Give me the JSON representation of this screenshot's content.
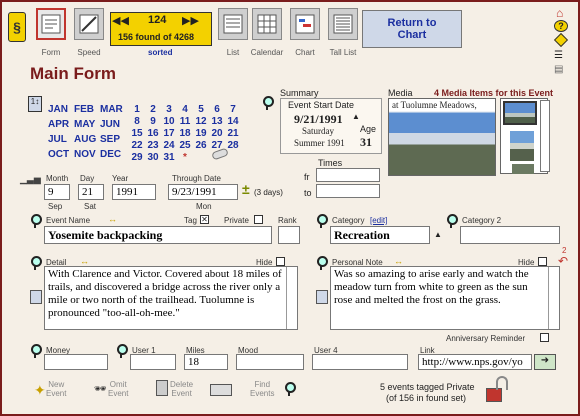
{
  "toolbar": {
    "form_label": "Form",
    "speed_label": "Speed",
    "record_number": "124",
    "found_text": "156 found of 4268",
    "sorted_label": "sorted",
    "list_label": "List",
    "calendar_label": "Calendar",
    "chart_label": "Chart",
    "tall_list_label": "Tall List",
    "return_button": "Return to\nChart"
  },
  "page_title": "Main Form",
  "calendar": {
    "months": [
      "JAN",
      "FEB",
      "MAR",
      "APR",
      "MAY",
      "JUN",
      "JUL",
      "AUG",
      "SEP",
      "OCT",
      "NOV",
      "DEC"
    ],
    "days_rows": [
      [
        "1",
        "2",
        "3",
        "4",
        "5",
        "6",
        "7"
      ],
      [
        "8",
        "9",
        "10",
        "11",
        "12",
        "13",
        "14"
      ],
      [
        "15",
        "16",
        "17",
        "18",
        "19",
        "20",
        "21"
      ],
      [
        "22",
        "23",
        "24",
        "25",
        "26",
        "27",
        "28"
      ],
      [
        "29",
        "30",
        "31",
        "*"
      ]
    ]
  },
  "summary": {
    "heading": "Summary",
    "start_label": "Event Start Date",
    "start_date": "9/21/1991",
    "weekday": "Saturday",
    "season": "Summer 1991",
    "age_label": "Age",
    "age": "31"
  },
  "media": {
    "heading": "Media",
    "count_text": "4 Media Items for this Event",
    "caption": "at Tuolumne Meadows,"
  },
  "times": {
    "heading": "Times",
    "fr_label": "fr",
    "to_label": "to"
  },
  "date": {
    "month_label": "Month",
    "day_label": "Day",
    "year_label": "Year",
    "through_label": "Through Date",
    "month": "9",
    "day": "21",
    "year": "1991",
    "through": "9/23/1991",
    "month_sub": "Sep",
    "day_sub": "Sat",
    "through_sub": "Mon",
    "duration": "(3 days)"
  },
  "event": {
    "name_label": "Event Name",
    "name": "Yosemite backpacking",
    "tag_label": "Tag",
    "private_label": "Private",
    "rank_label": "Rank",
    "category_label": "Category",
    "category_edit": "[edit]",
    "category": "Recreation",
    "category2_label": "Category 2"
  },
  "detail": {
    "label": "Detail",
    "hide_label": "Hide",
    "text": "With Clarence and Victor. Covered about 18 miles of trails, and discovered a bridge across the river only a mile or two north of the trailhead. Tuolumne is pronounced \"too-all-oh-mee.\""
  },
  "personal": {
    "label": "Personal Note",
    "hide_label": "Hide",
    "count": "2",
    "text": "Was so amazing to arise early and watch the meadow turn from white to green as the sun rose and melted the frost on the grass.",
    "anniversary_label": "Anniversary Reminder"
  },
  "bottom_fields": {
    "money_label": "Money",
    "user1_label": "User 1",
    "miles_label": "Miles",
    "miles": "18",
    "mood_label": "Mood",
    "user4_label": "User 4",
    "link_label": "Link",
    "link": "http://www.nps.gov/yo"
  },
  "footer": {
    "new_event": "New\nEvent",
    "omit_event": "Omit\nEvent",
    "delete_event": "Delete\nEvent",
    "find_events": "Find\nEvents",
    "status_line1": "5 events tagged Private",
    "status_line2": "(of 156 in found set)"
  },
  "colors": {
    "accent": "#7a1c1c",
    "navy": "#1b2fa0",
    "background": "#f5efe6"
  }
}
